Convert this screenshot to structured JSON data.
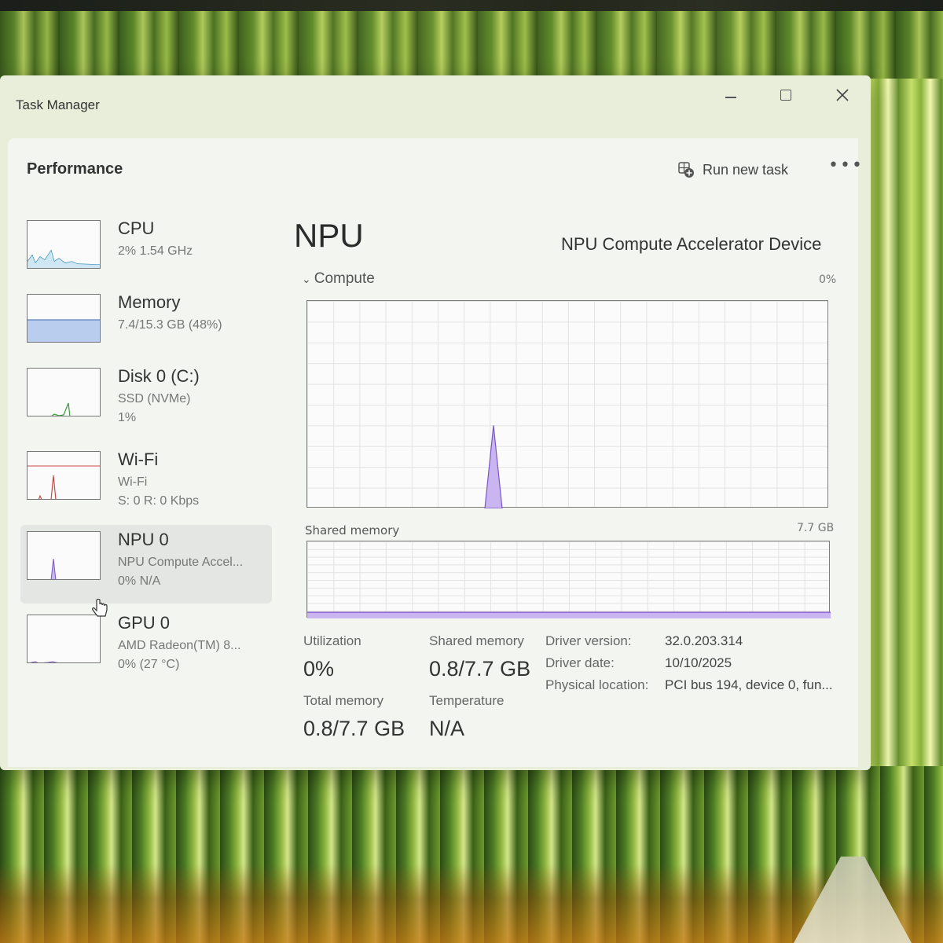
{
  "window": {
    "title": "Task Manager"
  },
  "header": {
    "section_title": "Performance",
    "run_new_task_label": "Run new task",
    "more_label": "•••"
  },
  "sidebar": {
    "items": [
      {
        "name": "CPU",
        "sub1": "2%  1.54 GHz",
        "sub2": "",
        "color": "#1d7fb0"
      },
      {
        "name": "Memory",
        "sub1": "7.4/15.3 GB (48%)",
        "sub2": "",
        "color": "#7b9fd6"
      },
      {
        "name": "Disk 0 (C:)",
        "sub1": "SSD (NVMe)",
        "sub2": "1%",
        "color": "#3a9a3a"
      },
      {
        "name": "Wi-Fi",
        "sub1": "Wi-Fi",
        "sub2": "S: 0  R: 0 Kbps",
        "color": "#c84a4a"
      },
      {
        "name": "NPU 0",
        "sub1": "NPU Compute Accel...",
        "sub2": "0%  N/A",
        "color": "#7a55c8",
        "selected": true
      },
      {
        "name": "GPU 0",
        "sub1": "AMD Radeon(TM) 8...",
        "sub2": "0%  (27 °C)",
        "color": "#7a55c8"
      }
    ]
  },
  "main": {
    "title": "NPU",
    "device_name": "NPU Compute Accelerator Device",
    "compute_label": "Compute",
    "compute_max": "0%",
    "shared_memory_label": "Shared memory",
    "shared_memory_max": "7.7 GB",
    "compute_peak_level": 0.4,
    "shared_memory_level": 0.08
  },
  "stats": {
    "utilization_label": "Utilization",
    "utilization_value": "0%",
    "shared_memory_label": "Shared memory",
    "shared_memory_value": "0.8/7.7 GB",
    "total_memory_label": "Total memory",
    "total_memory_value": "0.8/7.7 GB",
    "temperature_label": "Temperature",
    "temperature_value": "N/A"
  },
  "info": {
    "driver_version_label": "Driver version:",
    "driver_version_value": "32.0.203.314",
    "driver_date_label": "Driver date:",
    "driver_date_value": "10/10/2025",
    "physical_location_label": "Physical location:",
    "physical_location_value": "PCI bus 194, device 0, fun..."
  },
  "colors": {
    "npu_accent": "#7a55c8",
    "npu_fill": "#c9b5ef"
  }
}
